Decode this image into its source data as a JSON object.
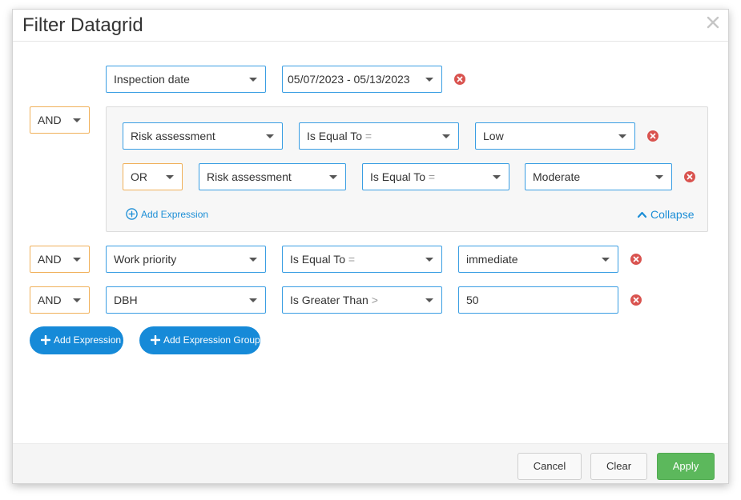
{
  "dialog": {
    "title": "Filter Datagrid",
    "close_glyph": "×"
  },
  "colors": {
    "accent_blue": "#168ad8",
    "border_blue": "#3a9ee3",
    "logic_orange": "#f0b05a",
    "remove_red": "#d9534f",
    "apply_green": "#5cb85c"
  },
  "rows": {
    "r1": {
      "field": "Inspection date",
      "value": "05/07/2023 - 05/13/2023"
    },
    "group": {
      "logic": "AND",
      "g1": {
        "field": "Risk assessment",
        "operator": "Is Equal To",
        "operator_symbol": "=",
        "value": "Low"
      },
      "g2": {
        "logic": "OR",
        "field": "Risk assessment",
        "operator": "Is Equal To",
        "operator_symbol": "=",
        "value": "Moderate"
      },
      "add_expression": "Add Expression",
      "collapse": "Collapse"
    },
    "r3": {
      "logic": "AND",
      "field": "Work priority",
      "operator": "Is Equal To",
      "operator_symbol": "=",
      "value": "immediate"
    },
    "r4": {
      "logic": "AND",
      "field": "DBH",
      "operator": "Is Greater Than",
      "operator_symbol": ">",
      "value": "50"
    }
  },
  "actions": {
    "add_expression": "Add Expression",
    "add_expression_group": "Add Expression Group"
  },
  "footer": {
    "cancel": "Cancel",
    "clear": "Clear",
    "apply": "Apply"
  },
  "icons": [
    "close-icon",
    "remove-icon",
    "add-circle-icon",
    "chevron-up-icon",
    "plus-icon",
    "caret-down-icon"
  ]
}
